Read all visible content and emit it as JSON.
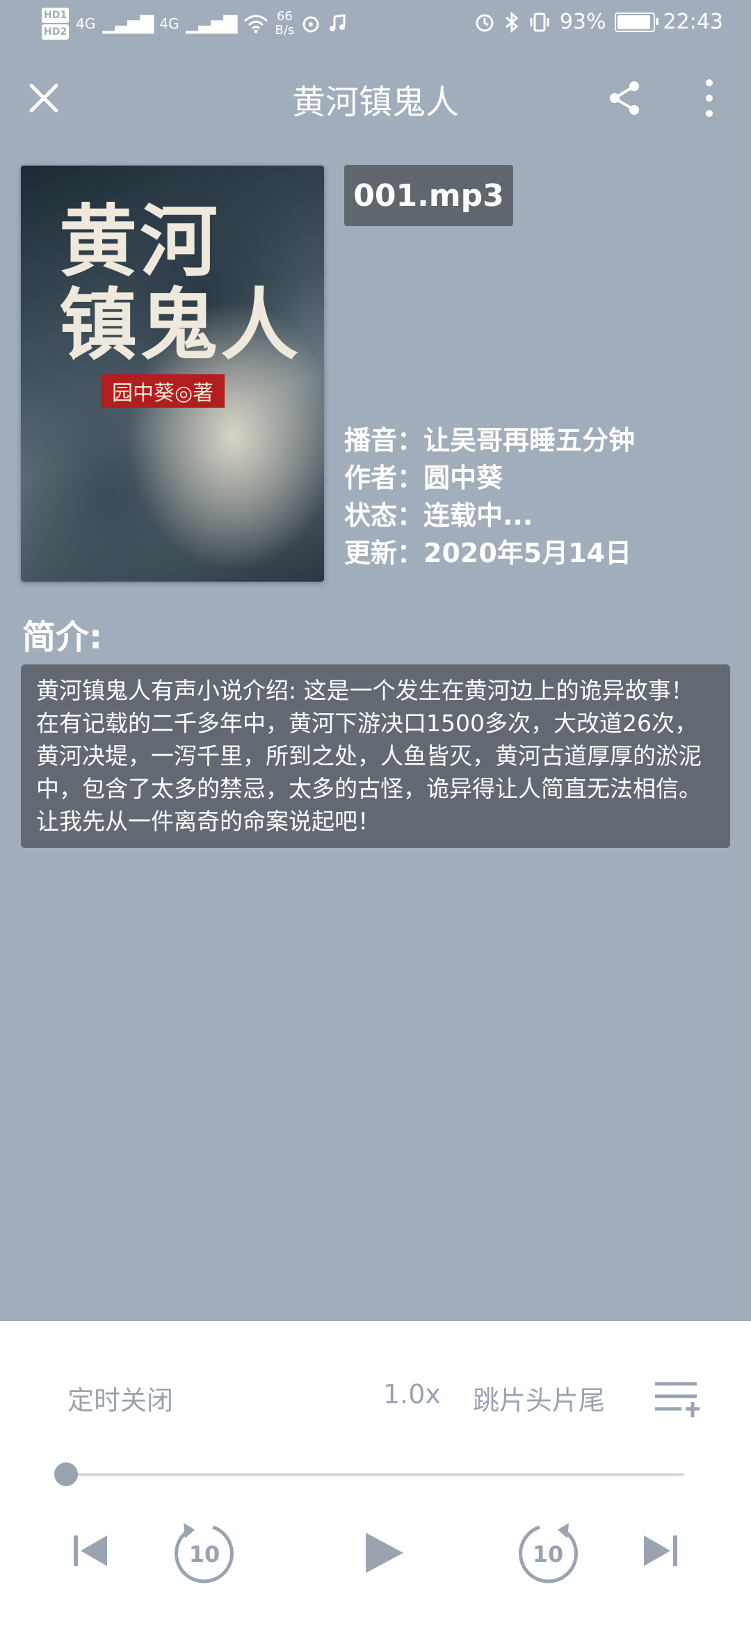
{
  "status_bar": {
    "hd1": "HD1",
    "hd2": "HD2",
    "net1": "4G",
    "net2": "4G",
    "speed_value": "66",
    "speed_unit": "B/s",
    "battery": "93%",
    "battery_level": 0.93,
    "time": "22:43"
  },
  "header": {
    "title": "黄河镇鬼人"
  },
  "cover": {
    "title_line1": "黄河",
    "title_line2": "镇鬼人",
    "author_label": "园中葵◎著"
  },
  "track": {
    "file_name": "001.mp3"
  },
  "meta": {
    "narrator": "播音：让吴哥再睡五分钟",
    "author": "作者：圆中葵",
    "status": "状态：连载中...",
    "updated": "更新：2020年5月14日"
  },
  "intro": {
    "label": "简介:",
    "text": "黄河镇鬼人有声小说介绍: 这是一个发生在黄河边上的诡异故事！在有记载的二千多年中，黄河下游决口1500多次，大改道26次，黄河决堤，一泻千里，所到之处，人鱼皆灭，黄河古道厚厚的淤泥中，包含了太多的禁忌，太多的古怪，诡异得让人简直无法相信。让我先从一件离奇的命案说起吧！"
  },
  "player": {
    "timer_label": "定时关闭",
    "speed_label": "1.0x",
    "skip_label": "跳片头片尾",
    "progress": 0.0,
    "rewind_seconds": "10",
    "forward_seconds": "10"
  },
  "colors": {
    "background": "#a2adbc",
    "panel": "#626973",
    "player_bg": "#ffffff",
    "player_icon": "#9aa3b0"
  }
}
